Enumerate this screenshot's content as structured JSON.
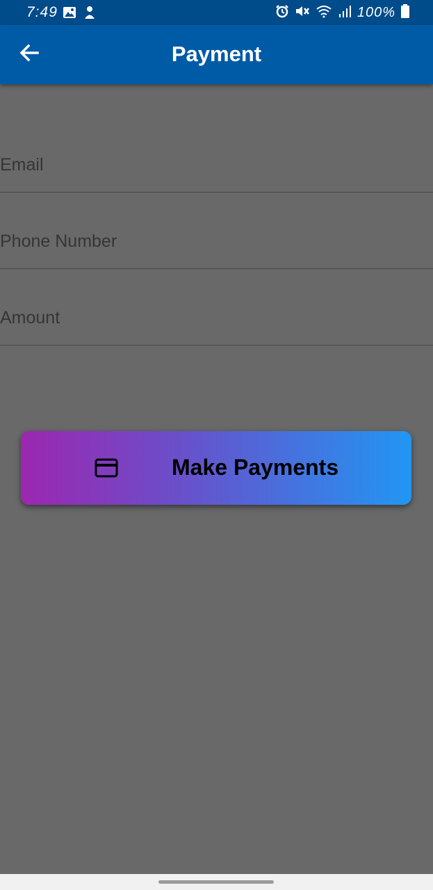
{
  "status_bar": {
    "time": "7:49",
    "battery": "100%",
    "left_icons": [
      "gallery-icon",
      "person-icon"
    ],
    "right_icons": [
      "alarm-icon",
      "mute-icon",
      "wifi-icon",
      "signal-icon",
      "battery-icon"
    ]
  },
  "app_bar": {
    "title": "Payment",
    "back_icon": "arrow-back-icon"
  },
  "form": {
    "email_placeholder": "Email",
    "phone_placeholder": "Phone Number",
    "amount_placeholder": "Amount"
  },
  "pay_button": {
    "label": "Make Payments",
    "icon": "credit-card-icon"
  },
  "colors": {
    "status_bar": "#004b8a",
    "app_bar": "#005ba6",
    "background": "#696969",
    "gradient_start": "#9c27b0",
    "gradient_end": "#2196f3"
  }
}
